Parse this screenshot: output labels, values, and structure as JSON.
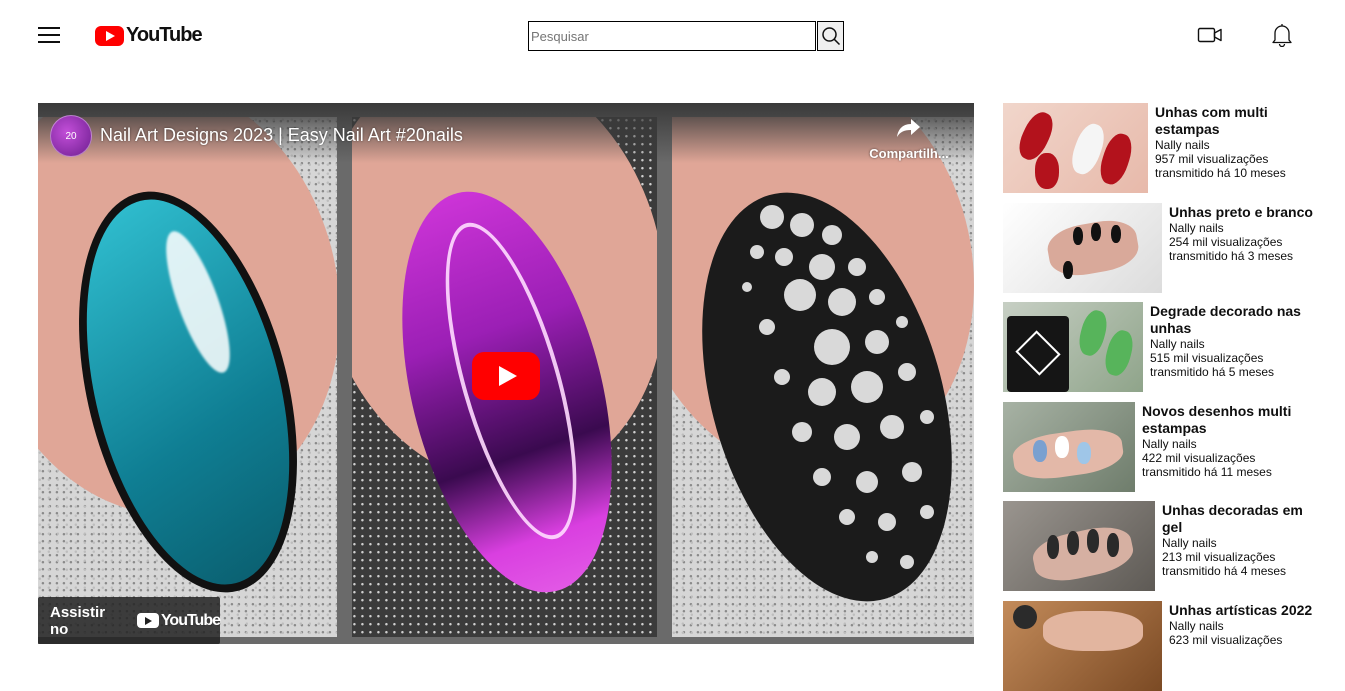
{
  "header": {
    "logo_text": "YouTube",
    "search_placeholder": "Pesquisar",
    "icons": [
      "menu-icon",
      "search-icon",
      "video-camera-icon",
      "bell-icon"
    ]
  },
  "player": {
    "video_title": "Nail Art Designs 2023 | Easy Nail Art #20nails",
    "channel_badge": "20",
    "share_label": "Compartilh...",
    "watch_on_label": "Assistir no",
    "watch_on_brand": "YouTube",
    "colors": {
      "play": "#ff0000",
      "nail_teal": "#1c9bb0",
      "nail_magenta": "#c02ed1",
      "nail_black": "#1b1b1b"
    }
  },
  "related": [
    {
      "title": "Unhas com multi estampas",
      "channel": "Nally nails",
      "views": "957 mil visualizações",
      "time": "transmitido há 10 meses"
    },
    {
      "title": "Unhas preto e branco",
      "channel": "Nally nails",
      "views": "254 mil visualizações",
      "time": "transmitido há 3 meses"
    },
    {
      "title": "Degrade decorado nas unhas",
      "channel": "Nally nails",
      "views": "515 mil visualizações",
      "time": "transmitido há 5 meses"
    },
    {
      "title": "Novos desenhos multi estampas",
      "channel": "Nally nails",
      "views": "422 mil visualizações",
      "time": "transmitido há 11 meses"
    },
    {
      "title": "Unhas decoradas em gel",
      "channel": "Nally nails",
      "views": "213 mil visualizações",
      "time": "transmitido há 4 meses"
    },
    {
      "title": "Unhas artísticas 2022",
      "channel": "Nally nails",
      "views": "623 mil visualizações",
      "time": ""
    }
  ]
}
